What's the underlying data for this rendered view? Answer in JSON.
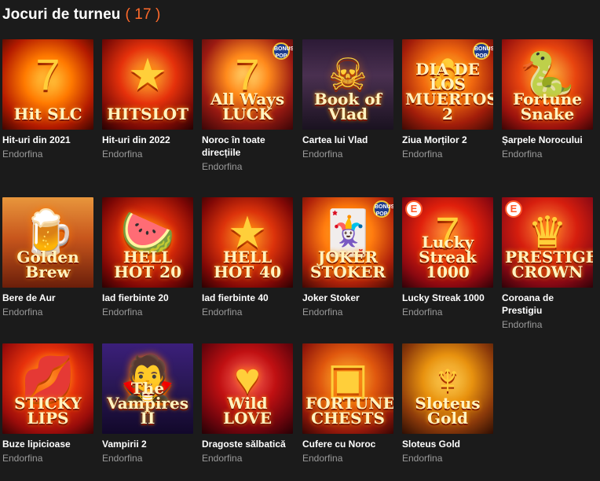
{
  "header": {
    "title": "Jocuri de turneu",
    "count": "( 17 )"
  },
  "games": [
    {
      "name": "Hit-uri din 2021",
      "provider": "Endorfina",
      "logo": "Hit SLC",
      "emblem": "7",
      "bg": "radial-gradient(circle at 50% 45%, #ffd34a 0%, #ff7a00 35%, #b41b00 70%, #3d0500 100%)",
      "badge": ""
    },
    {
      "name": "Hit-uri din 2022",
      "provider": "Endorfina",
      "logo": "HITSLOT",
      "emblem": "★",
      "bg": "radial-gradient(circle at 50% 40%, #ffbe3a 0%, #e5310b 40%, #7a0a05 75%, #250102 100%)",
      "badge": ""
    },
    {
      "name": "Noroc în toate direcțiile",
      "provider": "Endorfina",
      "logo": "All Ways LUCK",
      "emblem": "7",
      "bg": "radial-gradient(circle at 50% 40%, #ffe17a 0%, #ff8a1c 30%, #9b1a12 65%, #3a0507 100%)",
      "badge": "BONUS POP"
    },
    {
      "name": "Cartea lui Vlad",
      "provider": "Endorfina",
      "logo": "Book of Vlad",
      "emblem": "☠",
      "bg": "linear-gradient(180deg, #2c1a36 0%, #4a3050 40%, #1a1220 100%)",
      "badge": ""
    },
    {
      "name": "Ziua Morților 2",
      "provider": "Endorfina",
      "logo": "DIA DE LOS MUERTOS 2",
      "emblem": "✿",
      "bg": "radial-gradient(circle at 50% 40%, #ffd040 0%, #f26a0f 35%, #a21d0a 70%, #3d0904 100%)",
      "badge": "BONUS POP"
    },
    {
      "name": "Șarpele Norocului",
      "provider": "Endorfina",
      "logo": "Fortune Snake",
      "emblem": "🐍",
      "bg": "radial-gradient(circle at 50% 40%, #ffc448 0%, #e8450f 40%, #9a120d 75%, #3a0405 100%)",
      "badge": ""
    },
    {
      "name": "Bere de Aur",
      "provider": "Endorfina",
      "logo": "Golden Brew",
      "emblem": "🍺",
      "bg": "linear-gradient(180deg, #e8963c 0%, #c8561c 45%, #6a1e0a 100%)",
      "badge": ""
    },
    {
      "name": "Iad fierbinte 20",
      "provider": "Endorfina",
      "logo": "HELL HOT 20",
      "emblem": "🍉",
      "bg": "radial-gradient(circle at 50% 45%, #ff9a20 0%, #d82a0a 40%, #7c0705 75%, #2a0102 100%)",
      "badge": ""
    },
    {
      "name": "Iad fierbinte 40",
      "provider": "Endorfina",
      "logo": "HELL HOT 40",
      "emblem": "★",
      "bg": "radial-gradient(circle at 50% 45%, #ffa22a 0%, #dc330b 40%, #800806 75%, #2a0102 100%)",
      "badge": ""
    },
    {
      "name": "Joker Stoker",
      "provider": "Endorfina",
      "logo": "JOKER STOKER",
      "emblem": "🃏",
      "bg": "radial-gradient(circle at 50% 40%, #ffd24a 0%, #ff7c10 35%, #b0220a 70%, #3e0703 100%)",
      "badge": "BONUS POP"
    },
    {
      "name": "Lucky Streak 1000",
      "provider": "Endorfina",
      "logo": "Lucky Streak 1000",
      "emblem": "7",
      "bg": "radial-gradient(circle at 50% 40%, #ff9a3a 0%, #e0200c 40%, #8a0810 75%, #2e0208 100%)",
      "badge": "E"
    },
    {
      "name": "Coroana de Prestigiu",
      "provider": "Endorfina",
      "logo": "PRESTIGE CROWN",
      "emblem": "♛",
      "bg": "radial-gradient(circle at 50% 35%, #ff8a3a 0%, #d61e0e 40%, #860814 75%, #2e0208 100%)",
      "badge": "E"
    },
    {
      "name": "Buze lipicioase",
      "provider": "Endorfina",
      "logo": "STICKY LIPS",
      "emblem": "💋",
      "bg": "radial-gradient(circle at 50% 40%, #ff9a3a 0%, #e8320c 40%, #9a0c0a 75%, #3a0203 100%)",
      "badge": ""
    },
    {
      "name": "Vampirii 2",
      "provider": "Endorfina",
      "logo": "The Vampires II",
      "emblem": "🧛",
      "bg": "linear-gradient(180deg, #3b1f7a 0%, #2a1856 45%, #12082a 100%)",
      "badge": ""
    },
    {
      "name": "Dragoste sălbatică",
      "provider": "Endorfina",
      "logo": "Wild LOVE",
      "emblem": "♥",
      "bg": "radial-gradient(circle at 50% 40%, #ff6a5a 0%, #c01012 40%, #6a040c 75%, #250105 100%)",
      "badge": ""
    },
    {
      "name": "Cufere cu Noroc",
      "provider": "Endorfina",
      "logo": "FORTUNE CHESTS",
      "emblem": "▣",
      "bg": "radial-gradient(circle at 50% 40%, #ffc040 0%, #e0580e 40%, #92180a 75%, #340503 100%)",
      "badge": ""
    },
    {
      "name": "Sloteus Gold",
      "provider": "Endorfina",
      "logo": "Sloteus Gold",
      "emblem": "♆",
      "bg": "radial-gradient(circle at 50% 40%, #ffd860 0%, #e8920f 35%, #8c3a0a 70%, #2e0e03 100%)",
      "badge": ""
    }
  ]
}
